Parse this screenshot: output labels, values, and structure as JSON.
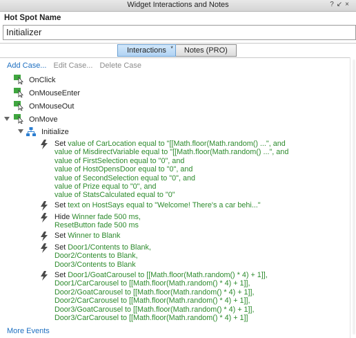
{
  "window": {
    "title": "Widget Interactions and Notes",
    "controls": [
      "?",
      "↙",
      "×"
    ]
  },
  "hotspot": {
    "label": "Hot Spot Name",
    "value": "Initializer"
  },
  "tabs": [
    {
      "label": "Interactions",
      "active": true
    },
    {
      "label": "Notes (PRO)",
      "active": false
    }
  ],
  "toolbar": {
    "add_case": "Add Case...",
    "edit_case": "Edit Case...",
    "delete_case": "Delete Case"
  },
  "events": [
    {
      "label": "OnClick"
    },
    {
      "label": "OnMouseEnter"
    },
    {
      "label": "OnMouseOut"
    },
    {
      "label": "OnMove",
      "expanded": true
    }
  ],
  "case": {
    "label": "Initialize"
  },
  "actions": [
    {
      "lines": [
        [
          {
            "t": "Set ",
            "c": "blk"
          },
          {
            "t": "value of CarLocation equal to \"[[Math.floor(Math.random() ...\", and",
            "c": "grn"
          }
        ],
        [
          {
            "t": "value of MisdirectVariable equal to \"[[Math.floor(Math.random() ...\", and",
            "c": "grn"
          }
        ],
        [
          {
            "t": "value of FirstSelection equal to \"0\", and",
            "c": "grn"
          }
        ],
        [
          {
            "t": "value of HostOpensDoor equal to \"0\", and",
            "c": "grn"
          }
        ],
        [
          {
            "t": "value of SecondSelection equal to \"0\", and",
            "c": "grn"
          }
        ],
        [
          {
            "t": "value of Prize equal to \"0\", and",
            "c": "grn"
          }
        ],
        [
          {
            "t": "value of StatsCalculated equal to \"0\"",
            "c": "grn"
          }
        ]
      ]
    },
    {
      "lines": [
        [
          {
            "t": "Set ",
            "c": "blk"
          },
          {
            "t": "text on HostSays equal to \"Welcome! There's a car behi...\"",
            "c": "grn"
          }
        ]
      ]
    },
    {
      "lines": [
        [
          {
            "t": "Hide ",
            "c": "blk"
          },
          {
            "t": "Winner fade 500 ms,",
            "c": "grn"
          }
        ],
        [
          {
            "t": "ResetButton fade 500 ms",
            "c": "grn"
          }
        ]
      ]
    },
    {
      "lines": [
        [
          {
            "t": "Set ",
            "c": "blk"
          },
          {
            "t": "Winner to Blank",
            "c": "grn"
          }
        ]
      ]
    },
    {
      "lines": [
        [
          {
            "t": "Set ",
            "c": "blk"
          },
          {
            "t": "Door1/Contents to Blank,",
            "c": "grn"
          }
        ],
        [
          {
            "t": "Door2/Contents to Blank,",
            "c": "grn"
          }
        ],
        [
          {
            "t": "Door3/Contents to Blank",
            "c": "grn"
          }
        ]
      ]
    },
    {
      "lines": [
        [
          {
            "t": "Set ",
            "c": "blk"
          },
          {
            "t": "Door1/GoatCarousel to [[Math.floor(Math.random() * 4) + 1]],",
            "c": "grn"
          }
        ],
        [
          {
            "t": "Door1/CarCarousel to [[Math.floor(Math.random() * 4) + 1]],",
            "c": "grn"
          }
        ],
        [
          {
            "t": "Door2/GoatCarousel to [[Math.floor(Math.random() * 4) + 1]],",
            "c": "grn"
          }
        ],
        [
          {
            "t": "Door2/CarCarousel to [[Math.floor(Math.random() * 4) + 1]],",
            "c": "grn"
          }
        ],
        [
          {
            "t": "Door3/GoatCarousel to [[Math.floor(Math.random() * 4) + 1]],",
            "c": "grn"
          }
        ],
        [
          {
            "t": "Door3/CarCarousel to [[Math.floor(Math.random() * 4) + 1]]",
            "c": "grn"
          }
        ]
      ]
    }
  ],
  "footer": {
    "more_events": "More Events"
  },
  "colors": {
    "link": "#1d6fc1",
    "action_text": "#2c8a2c",
    "event_icon": "#3fa63f",
    "tab_active": "#b0d2f3"
  }
}
